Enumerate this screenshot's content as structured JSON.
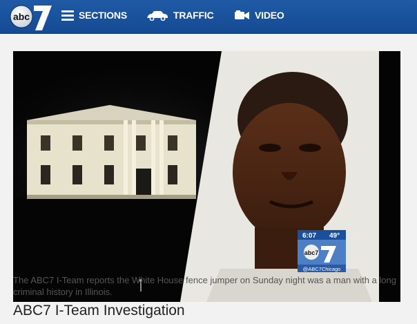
{
  "header": {
    "logo_text": "abc7",
    "nav": [
      {
        "label": "SECTIONS",
        "icon": "hamburger-menu-icon"
      },
      {
        "label": "TRAFFIC",
        "icon": "car-icon"
      },
      {
        "label": "VIDEO",
        "icon": "video-camera-icon"
      }
    ]
  },
  "article": {
    "image": {
      "description": "",
      "bug_time": "6:07",
      "bug_temp": "49°",
      "bug_handle": "@ABC7Chicago",
      "bug_logo": "abc7"
    },
    "caption": "The ABC7 I-Team reports the White House fence jumper on Sunday night was a man with a long criminal history in Illinois.",
    "headline": "ABC7 I-Team Investigation"
  },
  "colors": {
    "header_bg": "#1a53a0",
    "page_bg": "#f2f2f2",
    "caption_text": "#555555",
    "headline_text": "#222222"
  }
}
